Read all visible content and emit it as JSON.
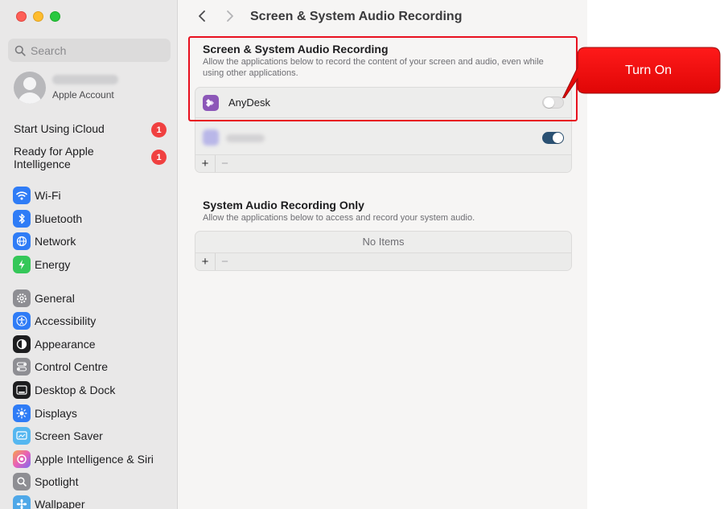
{
  "sidebar": {
    "search_placeholder": "Search",
    "account_sub": "Apple Account",
    "notices": [
      {
        "label": "Start Using iCloud",
        "badge": "1"
      },
      {
        "label": "Ready for Apple Intelligence",
        "badge": "1"
      }
    ],
    "items": [
      {
        "label": "Wi-Fi",
        "icon": "wifi-icon",
        "color": "#2f7cf6"
      },
      {
        "label": "Bluetooth",
        "icon": "bluetooth-icon",
        "color": "#2f7cf6"
      },
      {
        "label": "Network",
        "icon": "network-globe-icon",
        "color": "#2f7cf6"
      },
      {
        "label": "Energy",
        "icon": "energy-bolt-icon",
        "color": "#35c759"
      },
      {
        "label": "General",
        "icon": "gear-icon",
        "color": "#8e8e93"
      },
      {
        "label": "Accessibility",
        "icon": "accessibility-icon",
        "color": "#2f7cf6"
      },
      {
        "label": "Appearance",
        "icon": "appearance-icon",
        "color": "#1d1d1f"
      },
      {
        "label": "Control Centre",
        "icon": "control-centre-icon",
        "color": "#8e8e93"
      },
      {
        "label": "Desktop & Dock",
        "icon": "desktop-dock-icon",
        "color": "#1d1d1f"
      },
      {
        "label": "Displays",
        "icon": "displays-sun-icon",
        "color": "#2f7cf6"
      },
      {
        "label": "Screen Saver",
        "icon": "screen-saver-icon",
        "color": "#55b7f0"
      },
      {
        "label": "Apple Intelligence & Siri",
        "icon": "siri-icon",
        "color": "#e87fd0"
      },
      {
        "label": "Spotlight",
        "icon": "spotlight-search-icon",
        "color": "#8e8e93"
      },
      {
        "label": "Wallpaper",
        "icon": "wallpaper-icon",
        "color": "#4fa8e8"
      }
    ]
  },
  "header": {
    "title": "Screen & System Audio Recording"
  },
  "section_screen": {
    "title": "Screen & System Audio Recording",
    "description": "Allow the applications below to record the content of your screen and audio, even while using other applications.",
    "apps": [
      {
        "name": "AnyDesk",
        "enabled": false,
        "icon_color": "#8c57b8"
      },
      {
        "name": "",
        "enabled": true
      }
    ],
    "add_label": "+",
    "remove_label": "−"
  },
  "section_audio": {
    "title": "System Audio Recording Only",
    "description": "Allow the applications below to access and record your system audio.",
    "empty_label": "No Items",
    "add_label": "+",
    "remove_label": "−"
  },
  "annotation": {
    "callout_text": "Turn On",
    "color": "#e8101e"
  }
}
